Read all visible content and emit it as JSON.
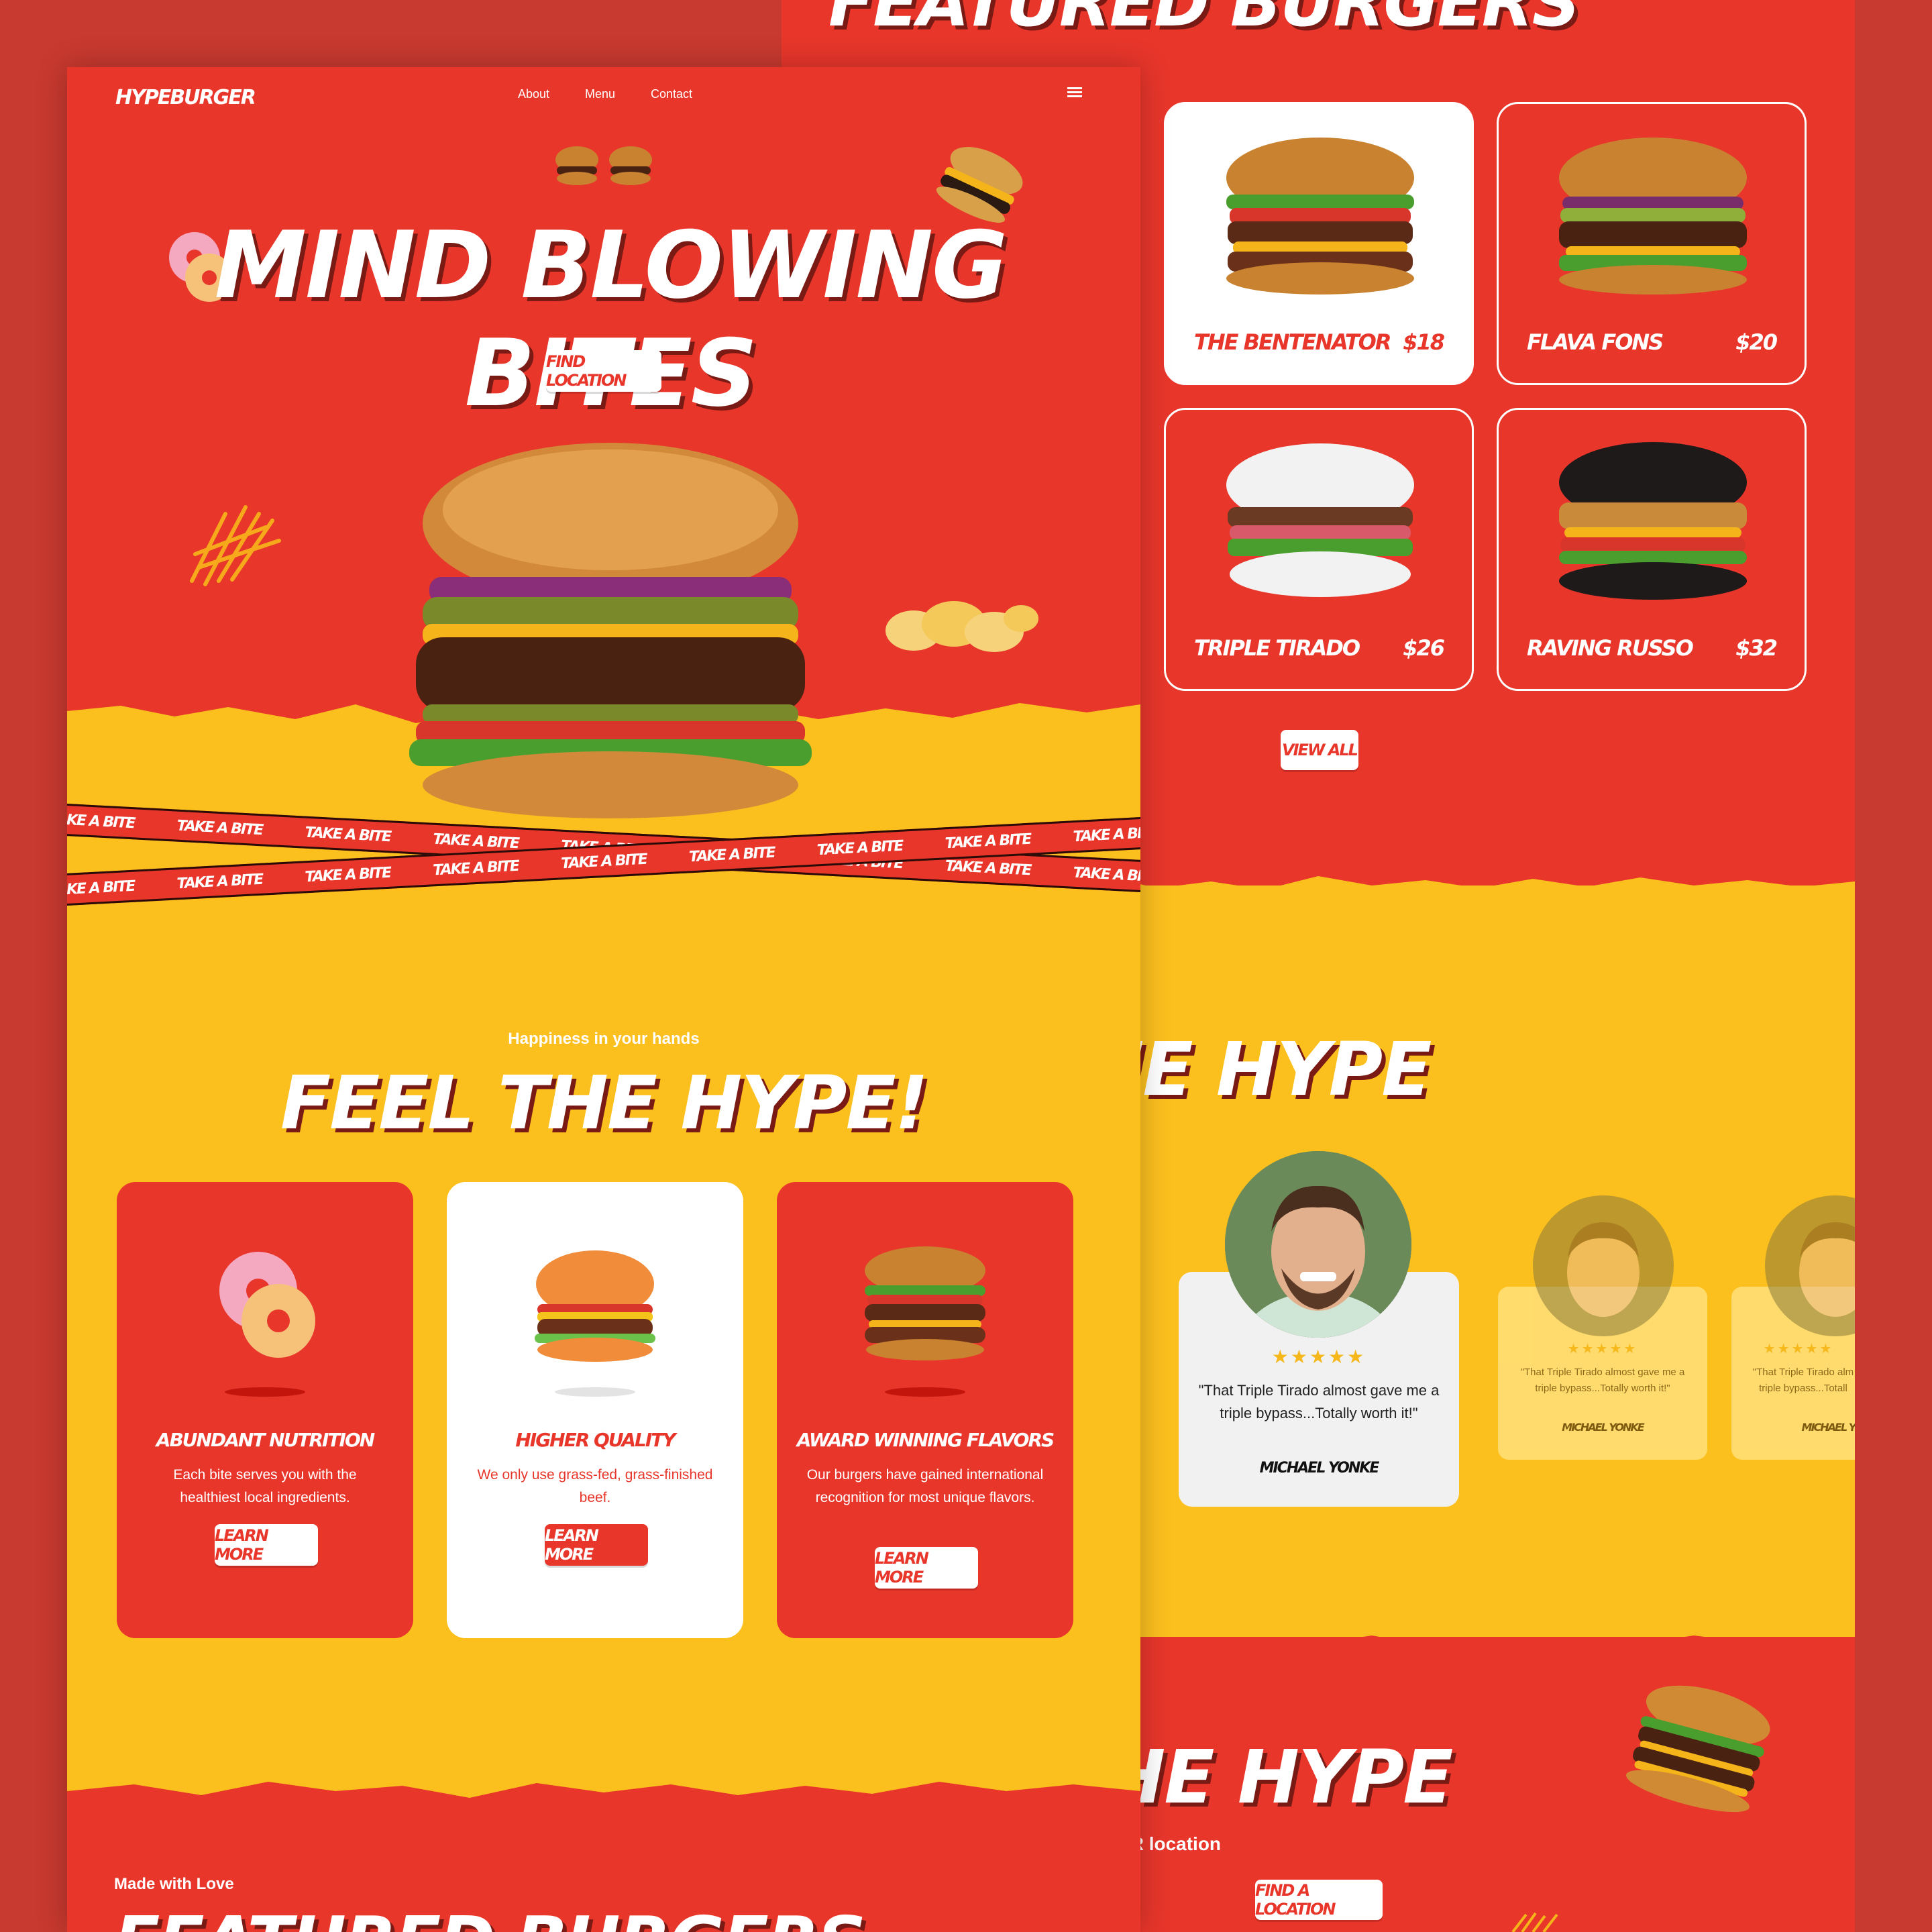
{
  "featured_page": {
    "heading": "FEATURED BURGERS",
    "burgers": [
      {
        "name": "THE BENTENATOR",
        "price": "$18"
      },
      {
        "name": "FLAVA FONS",
        "price": "$20"
      },
      {
        "name": "TRIPLE TIRADO",
        "price": "$26"
      },
      {
        "name": "RAVING RUSSO",
        "price": "$32"
      }
    ],
    "view_all": "VIEW ALL",
    "hear_heading": "HEAR THE HYPE",
    "testimonial": {
      "stars": "★★★★★",
      "quote": "\"That Triple Tirado almost gave me a triple bypass...Totally worth it!\"",
      "name": "MICHAEL YONKE"
    },
    "testimonial_faded_1": {
      "stars": "★★★★★",
      "quote": "\"That Triple Tirado almost gave me a triple bypass...Totally worth it!\"",
      "name": "MICHAEL YONKE"
    },
    "testimonial_faded_2": {
      "stars": "★★★★★",
      "quote": "\"That Triple Tirado alm triple bypass...Totall",
      "name": "MICHAEL YO"
    },
    "taste_heading": "TASTE THE HYPE",
    "visit_text": "ome visit us at your local HYPEBURGER location",
    "find_location": "FIND A LOCATION"
  },
  "home_page": {
    "nav": {
      "logo": "HYPEBURGER",
      "links": [
        "About",
        "Menu",
        "Contact"
      ]
    },
    "hero_title": "MIND BLOWING BITES",
    "find_location": "FIND LOCATION",
    "tape_text": "TAKE A BITE",
    "feel_sub": "Happiness in your hands",
    "feel_title": "FEEL THE HYPE!",
    "features": [
      {
        "title": "ABUNDANT NUTRITION",
        "text": "Each bite serves you with the healthiest local ingredients.",
        "button": "LEARN MORE"
      },
      {
        "title": "HIGHER QUALITY",
        "text": "We only use grass-fed, grass-finished beef.",
        "button": "LEARN MORE"
      },
      {
        "title": "AWARD WINNING FLAVORS",
        "text": "Our burgers have gained international recognition for most unique flavors.",
        "button": "LEARN MORE"
      }
    ],
    "made_with_love": "Made with Love",
    "featured_heading": "FEATURED BURGERS"
  },
  "colors": {
    "red": "#e8362b",
    "yellow": "#fbbf1e",
    "background": "#c8392f",
    "white": "#ffffff"
  }
}
